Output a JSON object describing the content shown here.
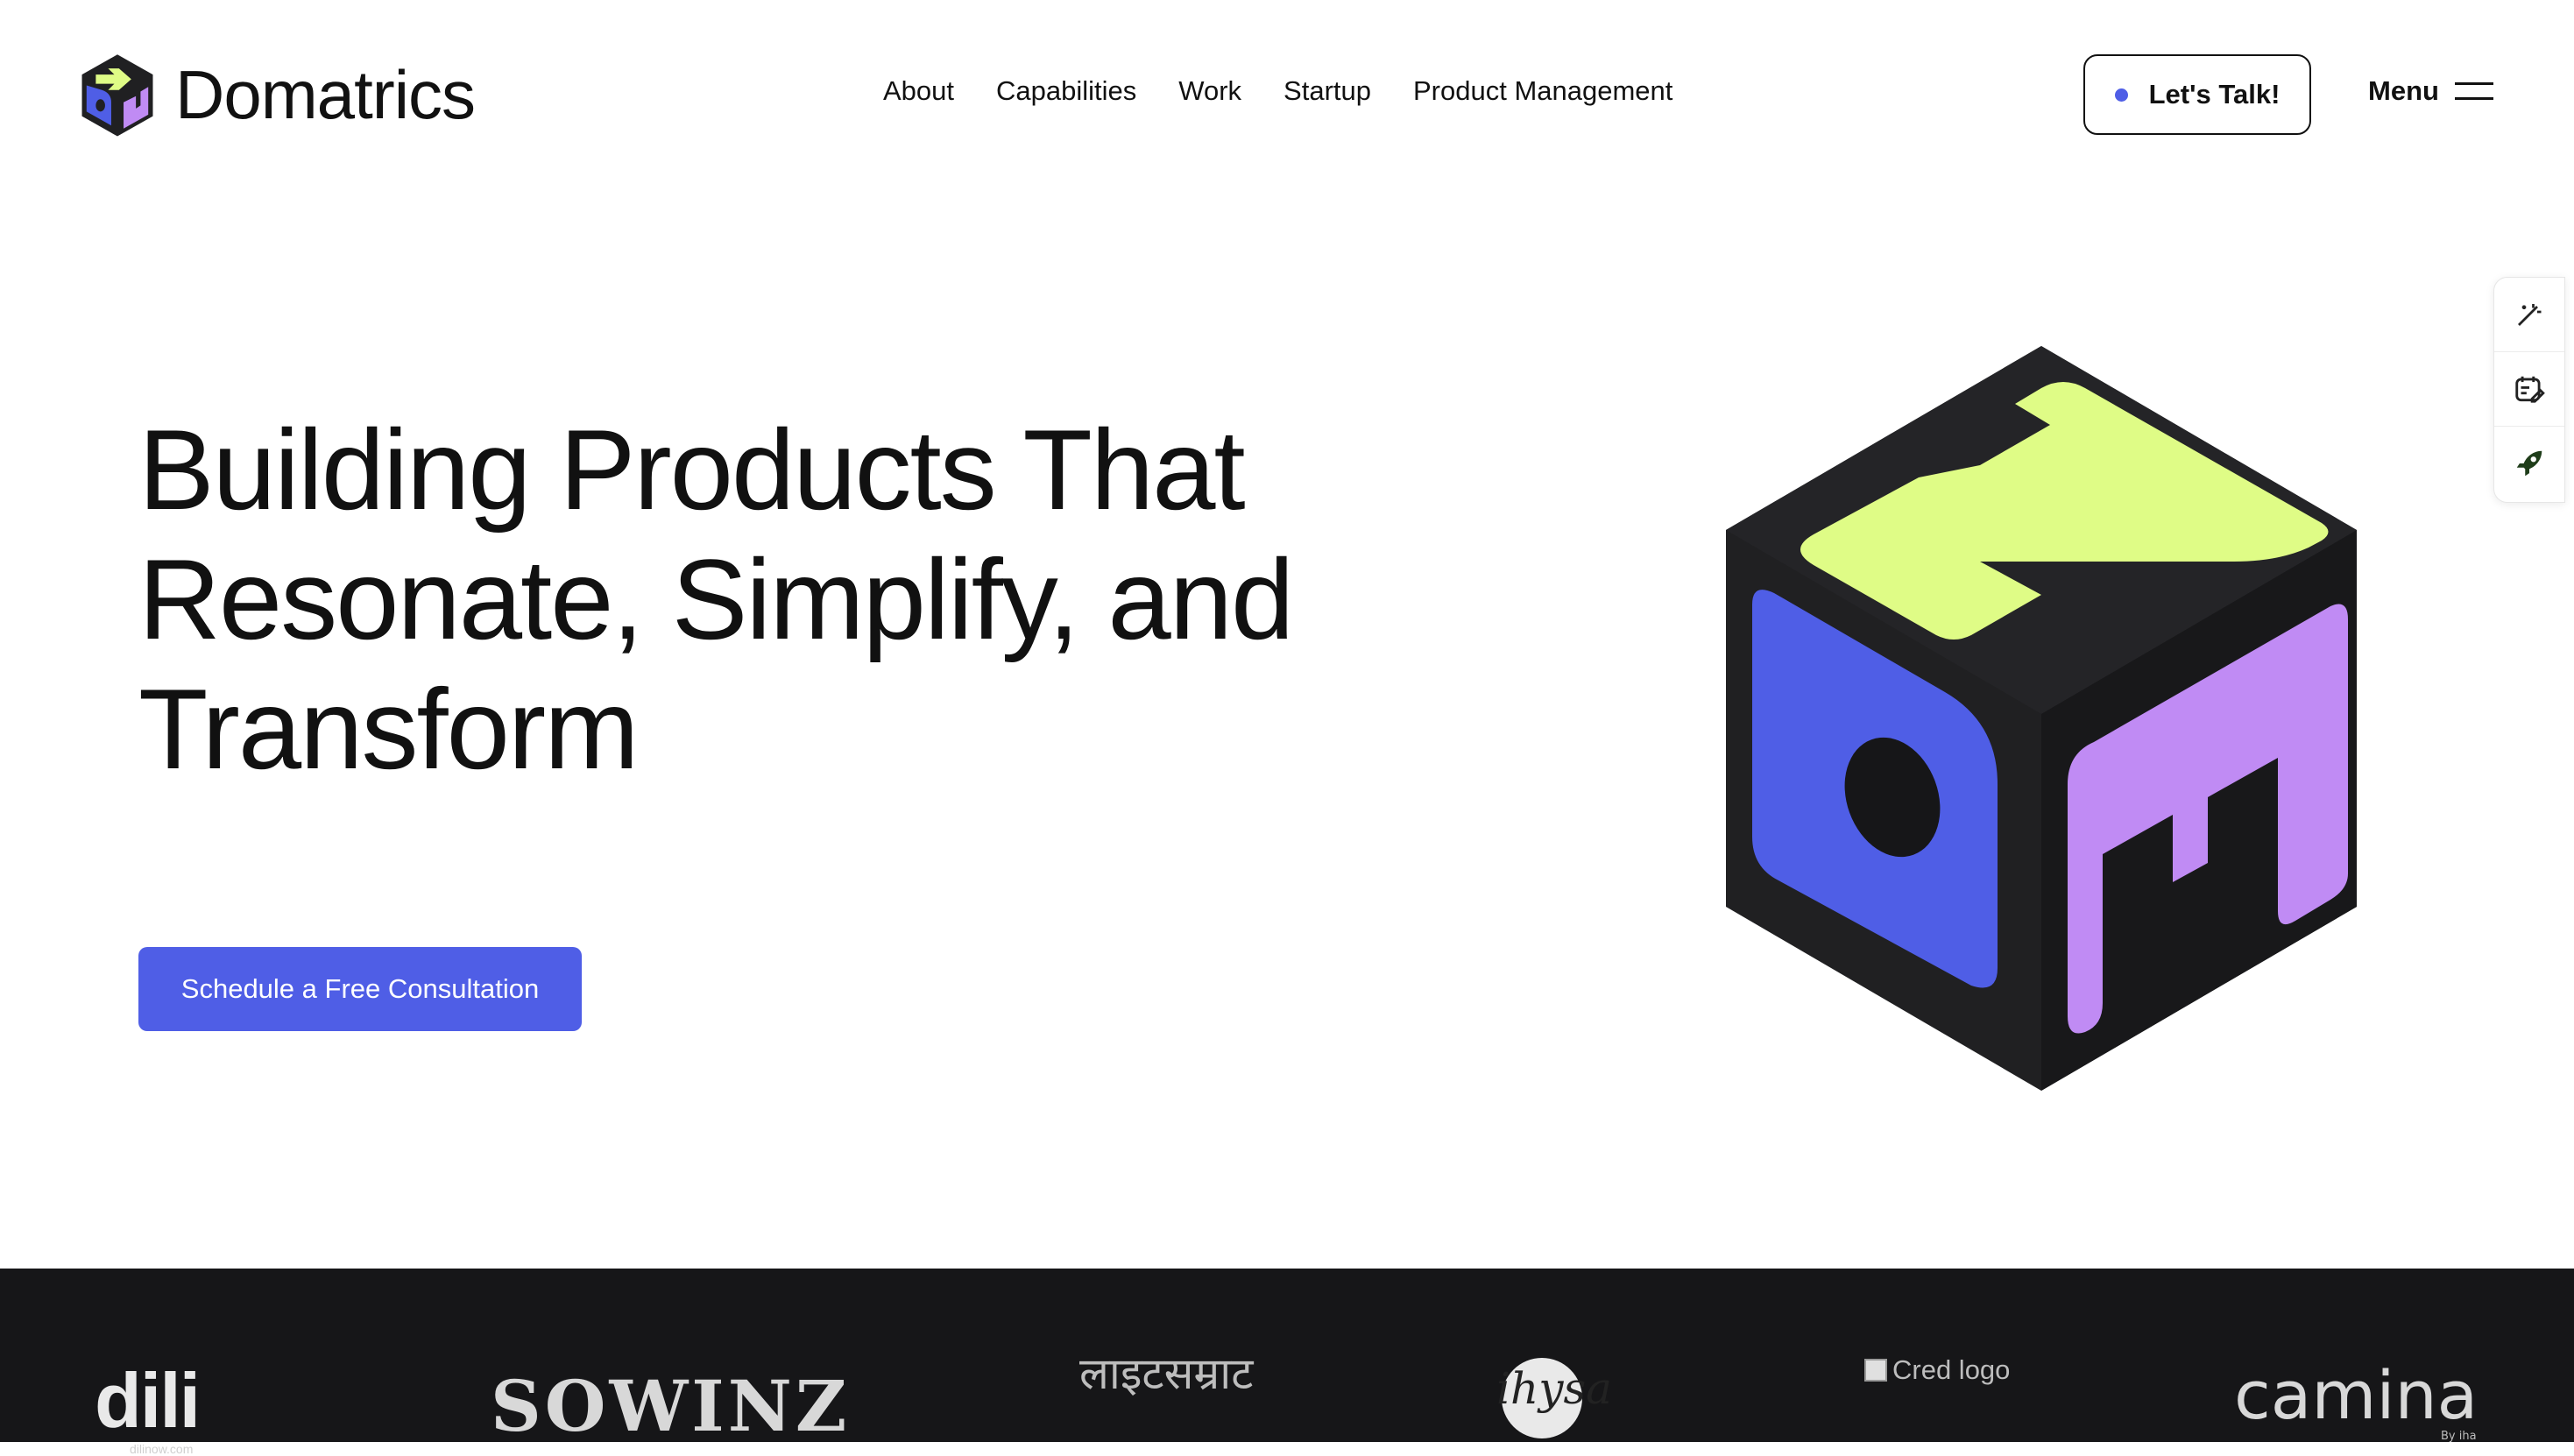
{
  "header": {
    "brand_name": "Domatrics",
    "nav": [
      "About",
      "Capabilities",
      "Work",
      "Startup",
      "Product Management"
    ],
    "cta_label": "Let's Talk!",
    "menu_label": "Menu"
  },
  "side_tools": [
    "magic-wand-icon",
    "calendar-edit-icon",
    "rocket-icon"
  ],
  "hero": {
    "title_lines": [
      "Building Products That",
      "Resonate, Simplify, and",
      "Transform"
    ],
    "cta_label": "Schedule a Free Consultation"
  },
  "colors": {
    "accent_blue": "#4f5ee6",
    "cube_dark": "#202022",
    "cube_lime": "#dffc86",
    "cube_blue": "#4f5ee6",
    "cube_purple": "#c08bf4",
    "logos_bg": "#161618"
  },
  "logos": {
    "dili": "dili",
    "dili_sub": "dilinow.com",
    "sowinz": "SOWINZ",
    "deva": "लाइटसम्राट",
    "ihysa": "ihysa",
    "cred_alt": "Cred logo",
    "camina": "camina",
    "camina_sub": "By iha"
  }
}
